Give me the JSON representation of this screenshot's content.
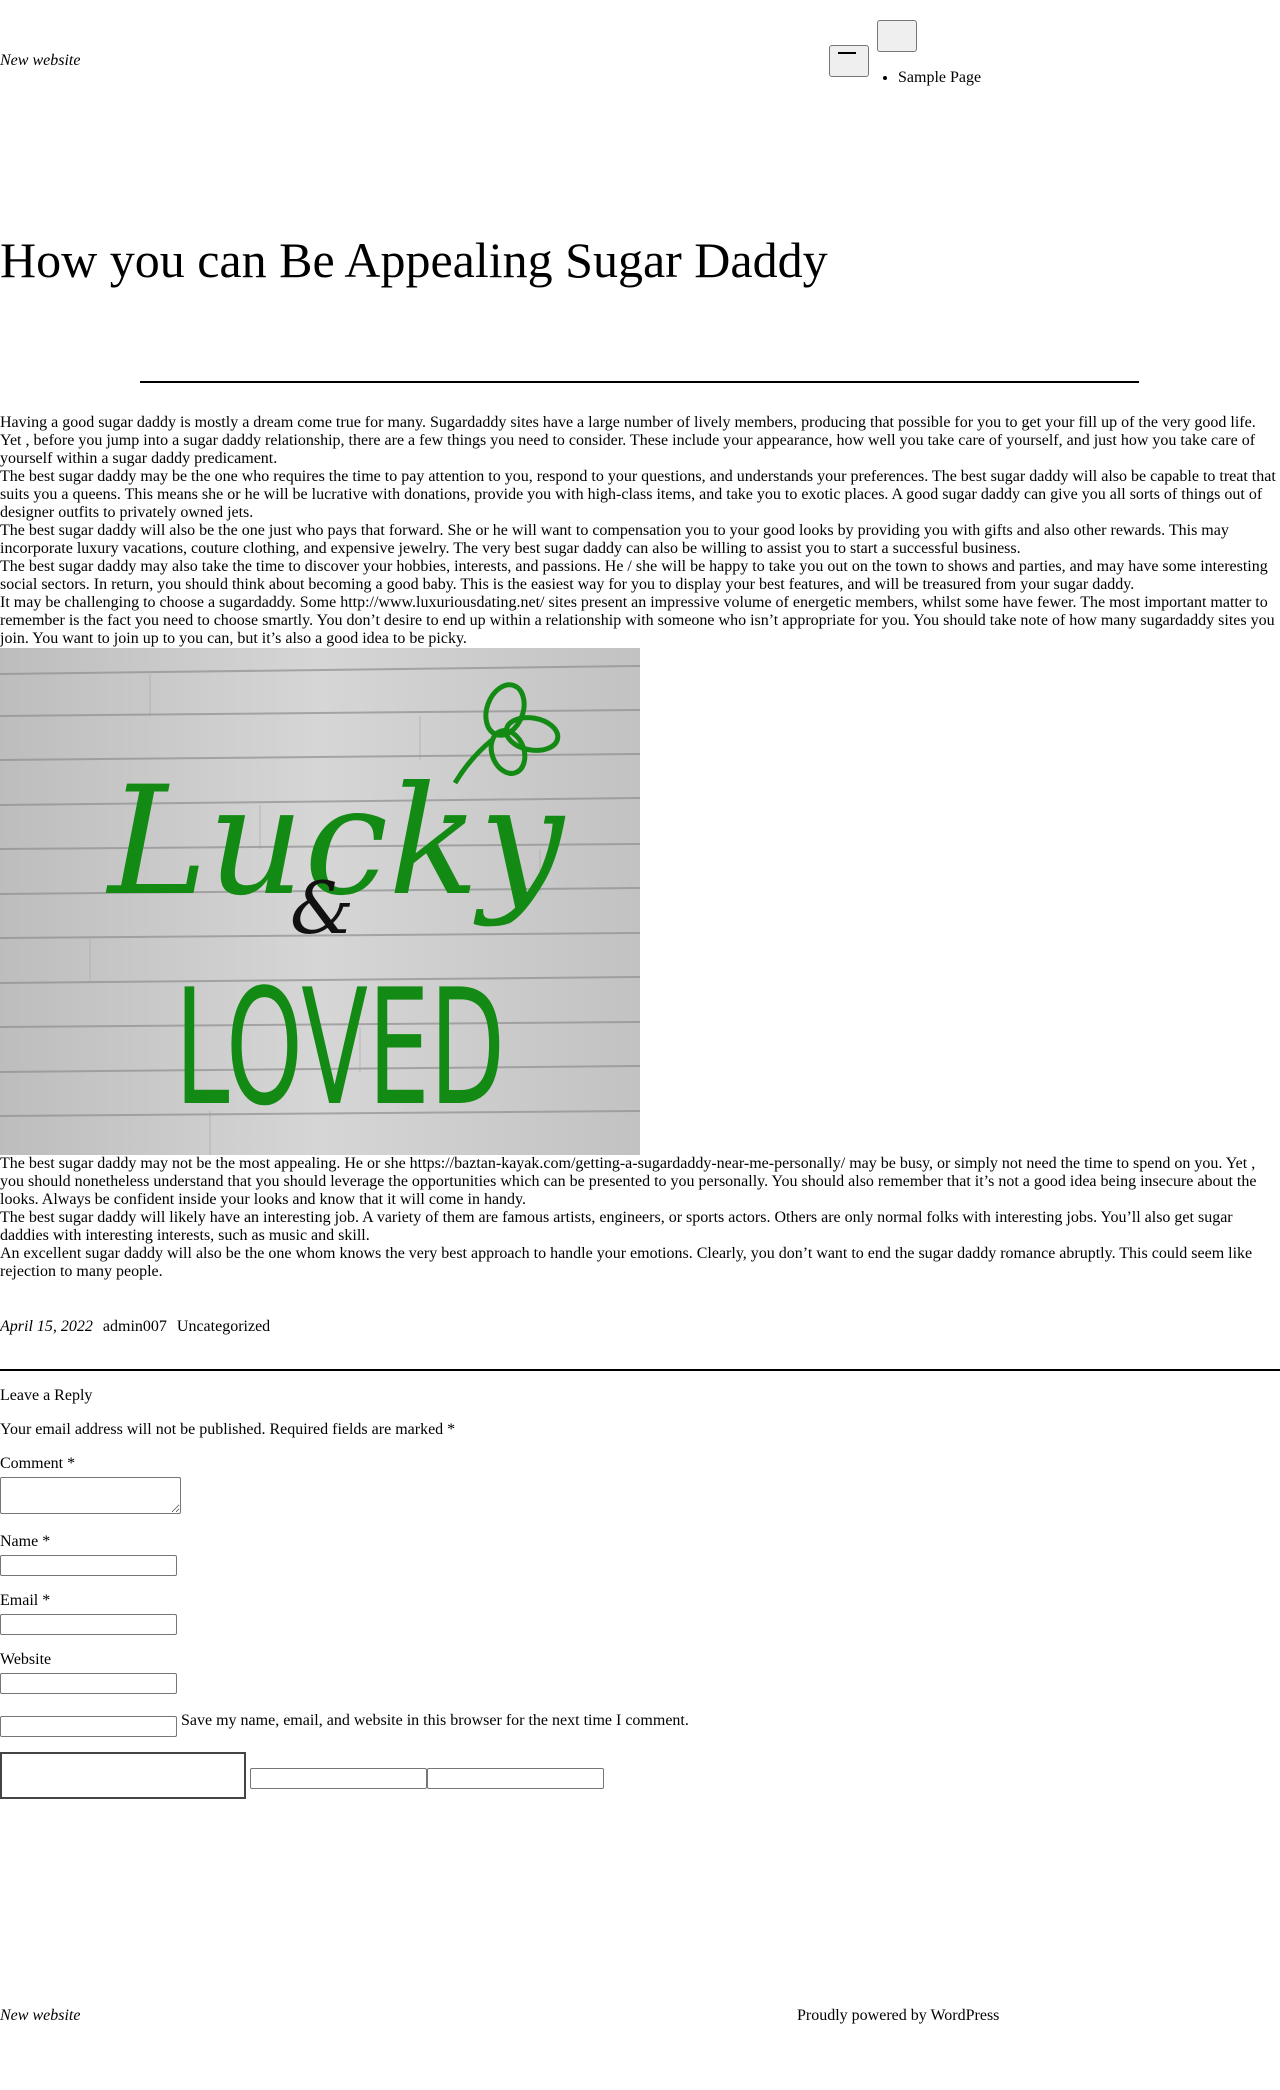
{
  "header": {
    "site_title": "New website",
    "nav": {
      "items": [
        {
          "label": "Sample Page"
        }
      ]
    }
  },
  "post": {
    "title": "How you can Be Appealing Sugar Daddy",
    "paragraphs": [
      "Having a good sugar daddy is mostly a dream come true for many. Sugardaddy sites have a large number of lively members, producing that possible for you to get your fill up of the very good life. Yet , before you jump into a sugar daddy relationship, there are a few things you need to consider. These include your appearance, how well you take care of yourself, and just how you take care of yourself within a sugar daddy predicament.",
      "The best sugar daddy may be the one who requires the time to pay attention to you, respond to your questions, and understands your preferences. The best sugar daddy will also be capable to treat that suits you a queens. This means she or he will be lucrative with donations, provide you with high-class items, and take you to exotic places. A good sugar daddy can give you all sorts of things out of designer outfits to privately owned jets.",
      "The best sugar daddy will also be the one just who pays that forward. She or he will want to compensation you to your good looks by providing you with gifts and also other rewards. This may incorporate luxury vacations, couture clothing, and expensive jewelry. The very best sugar daddy can also be willing to assist you to start a successful business.",
      "The best sugar daddy may also take the time to discover your hobbies, interests, and passions. He / she will be happy to take you out on the town to shows and parties, and may have some interesting social sectors. In return, you should think about becoming a good baby. This is the easiest way for you to display your best features, and will be treasured from your sugar daddy.",
      "It may be challenging to choose a sugardaddy. Some http://www.luxuriousdating.net/ sites present an impressive volume of energetic members, whilst some have fewer. The most important matter to remember is the fact you need to choose smartly. You don’t desire to end up within a relationship with someone who isn’t appropriate for you. You should take note of how many sugardaddy sites you join. You want to join up to you can, but it’s also a good idea to be picky."
    ],
    "image": {
      "word_top": "Lucky",
      "word_mid": "&",
      "word_bottom": "LOVED",
      "colors": {
        "green": "#138a13",
        "ampersand": "#111111",
        "wood": "#c9c9c9"
      }
    },
    "paragraphs_after": [
      "The best sugar daddy may not be the most appealing. He or she https://baztan-kayak.com/getting-a-sugardaddy-near-me-personally/ may be busy, or simply not need the time to spend on you. Yet , you should nonetheless understand that you should leverage the opportunities which can be presented to you personally. You should also remember that it’s not a good idea being insecure about the looks. Always be confident inside your looks and know that it will come in handy.",
      "The best sugar daddy will likely have an interesting job. A variety of them are famous artists, engineers, or sports actors. Others are only normal folks with interesting jobs. You’ll also get sugar daddies with interesting interests, such as music and skill.",
      "An excellent sugar daddy will also be the one whom knows the very best approach to handle your emotions. Clearly, you don’t want to end the sugar daddy romance abruptly. This could seem like rejection to many people."
    ],
    "meta": {
      "date": "April 15, 2022",
      "author": "admin007",
      "category": "Uncategorized"
    }
  },
  "comments": {
    "reply_title": "Leave a Reply",
    "notes": "Your email address will not be published. Required fields are marked *",
    "comment_label": "Comment *",
    "name_label": "Name *",
    "email_label": "Email *",
    "website_label": "Website",
    "consent_label": "Save my name, email, and website in this browser for the next time I comment."
  },
  "footer": {
    "site_title": "New website",
    "powered_by": "Proudly powered by WordPress"
  }
}
